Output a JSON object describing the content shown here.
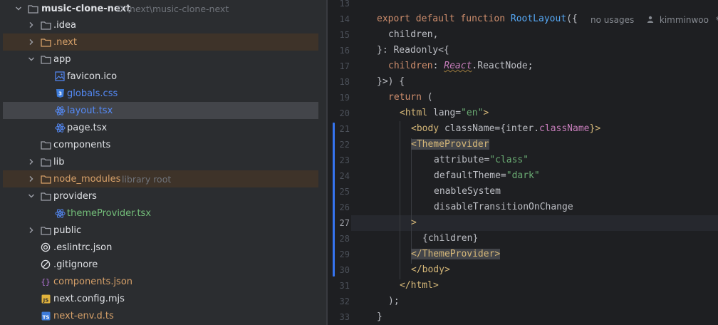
{
  "project_tree": {
    "root": {
      "name": "music-clone-next",
      "path": "D:\\next\\music-clone-next"
    },
    "items": [
      {
        "label": ".idea",
        "type": "folder",
        "hint": "",
        "color": "#dfe1e5"
      },
      {
        "label": ".next",
        "type": "folder-excluded",
        "hint": "",
        "color": "#d6a069"
      },
      {
        "label": "app",
        "type": "folder",
        "hint": "",
        "color": "#dfe1e5"
      },
      {
        "label": "favicon.ico",
        "type": "image",
        "hint": "",
        "color": "#dfe1e5"
      },
      {
        "label": "globals.css",
        "type": "css",
        "hint": "",
        "color": "#548af7"
      },
      {
        "label": "layout.tsx",
        "type": "react",
        "hint": "",
        "color": "#548af7"
      },
      {
        "label": "page.tsx",
        "type": "react",
        "hint": "",
        "color": "#dfe1e5"
      },
      {
        "label": "components",
        "type": "folder",
        "hint": "",
        "color": "#dfe1e5"
      },
      {
        "label": "lib",
        "type": "folder",
        "hint": "",
        "color": "#dfe1e5"
      },
      {
        "label": "node_modules",
        "type": "folder-excluded",
        "hint": "library root",
        "color": "#d6a069"
      },
      {
        "label": "providers",
        "type": "folder",
        "hint": "",
        "color": "#dfe1e5"
      },
      {
        "label": "themeProvider.tsx",
        "type": "react",
        "hint": "",
        "color": "#73bd79"
      },
      {
        "label": "public",
        "type": "folder",
        "hint": "",
        "color": "#dfe1e5"
      },
      {
        "label": ".eslintrc.json",
        "type": "eslint",
        "hint": "",
        "color": "#dfe1e5"
      },
      {
        "label": ".gitignore",
        "type": "ignore",
        "hint": "",
        "color": "#dfe1e5"
      },
      {
        "label": "components.json",
        "type": "json",
        "hint": "",
        "color": "#d6a069"
      },
      {
        "label": "next.config.mjs",
        "type": "js",
        "hint": "",
        "color": "#dfe1e5"
      },
      {
        "label": "next-env.d.ts",
        "type": "ts",
        "hint": "",
        "color": "#d6a069"
      }
    ]
  },
  "editor": {
    "inlay": {
      "usages": "no usages",
      "author": "kimminwoo",
      "more": "*"
    },
    "line_numbers": [
      "13",
      "14",
      "15",
      "16",
      "17",
      "18",
      "19",
      "20",
      "21",
      "22",
      "23",
      "24",
      "25",
      "26",
      "27",
      "28",
      "29",
      "30",
      "31",
      "32",
      "33"
    ],
    "current_line": "27",
    "tokens": {
      "l14": [
        "export",
        "default",
        "function",
        "RootLayout",
        "({"
      ],
      "l15": "children,",
      "l16": [
        "}: Readonly<{"
      ],
      "l17": [
        "children",
        ": ",
        "React",
        ".ReactNode;"
      ],
      "l18": "}>) {",
      "l19": [
        "return",
        " ("
      ],
      "l20": [
        "<html",
        " lang",
        "=",
        "\"en\"",
        ">"
      ],
      "l21": [
        "<body",
        " className",
        "={inter.",
        "className",
        "}>"
      ],
      "l22": [
        "<ThemeProvider"
      ],
      "l23": [
        "attribute",
        "=",
        "\"class\""
      ],
      "l24": [
        "defaultTheme",
        "=",
        "\"dark\""
      ],
      "l25": "enableSystem",
      "l26": "disableTransitionOnChange",
      "l27": ">",
      "l28": "{children}",
      "l29": [
        "</ThemeProvider",
        ">"
      ],
      "l30": [
        "</body",
        ">"
      ],
      "l31": [
        "</html",
        ">"
      ],
      "l32": ");",
      "l33": "}"
    }
  },
  "colors": {
    "tree_bg": "#2b2d30",
    "editor_bg": "#1e1f22",
    "keyword": "#cf8e6d",
    "function": "#56a8f5",
    "tag": "#d5b778",
    "string": "#6aab73",
    "property": "#c77dbb",
    "selection": "#43454a"
  }
}
